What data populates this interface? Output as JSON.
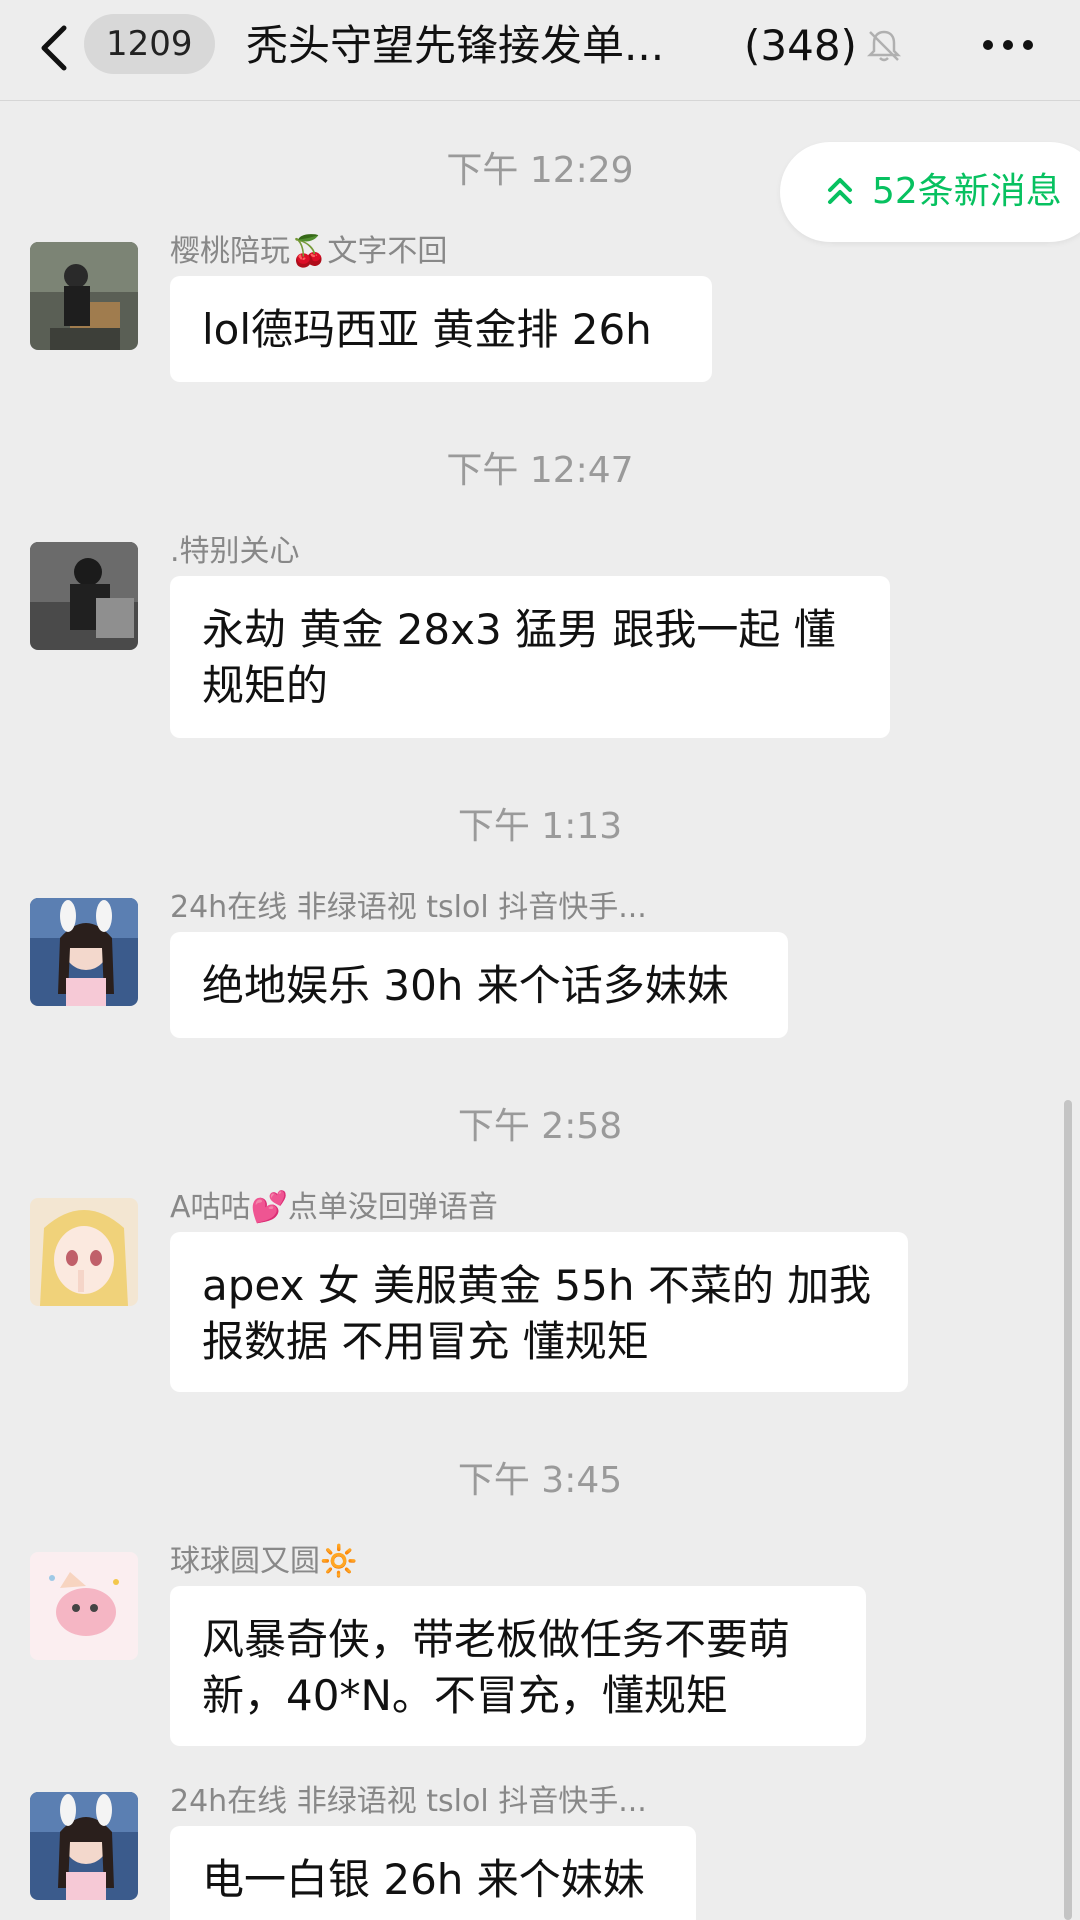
{
  "header": {
    "back_label": "",
    "unread_count": "1209",
    "title": "秃头守望先锋接发单...",
    "member_count": "(348)"
  },
  "new_messages": {
    "label": "52条新消息",
    "color": "#07c160"
  },
  "messages": [
    {
      "time": "下午 12:29",
      "sender": "樱桃陪玩🍒文字不回",
      "text": "lol德玛西亚 黄金排 26h"
    },
    {
      "time": "下午 12:47",
      "sender": ".特别关心",
      "text": "永劫 黄金 28x3 猛男 跟我一起 懂规矩的"
    },
    {
      "time": "下午 1:13",
      "sender": "24h在线 非绿语视 tslol 抖音快手...",
      "text": "绝地娱乐 30h 来个话多妹妹"
    },
    {
      "time": "下午 2:58",
      "sender": "A咕咕💕点单没回弹语音",
      "text": "apex 女 美服黄金 55h 不菜的 加我报数据 不用冒充 懂规矩"
    },
    {
      "time": "下午 3:45",
      "sender": "球球圆又圆🔆",
      "text": "风暴奇侠，带老板做任务不要萌新，40*N。不冒充，懂规矩"
    },
    {
      "time": "",
      "sender": "24h在线 非绿语视 tslol 抖音快手...",
      "text": "电一白银 26h 来个妹妹"
    }
  ]
}
